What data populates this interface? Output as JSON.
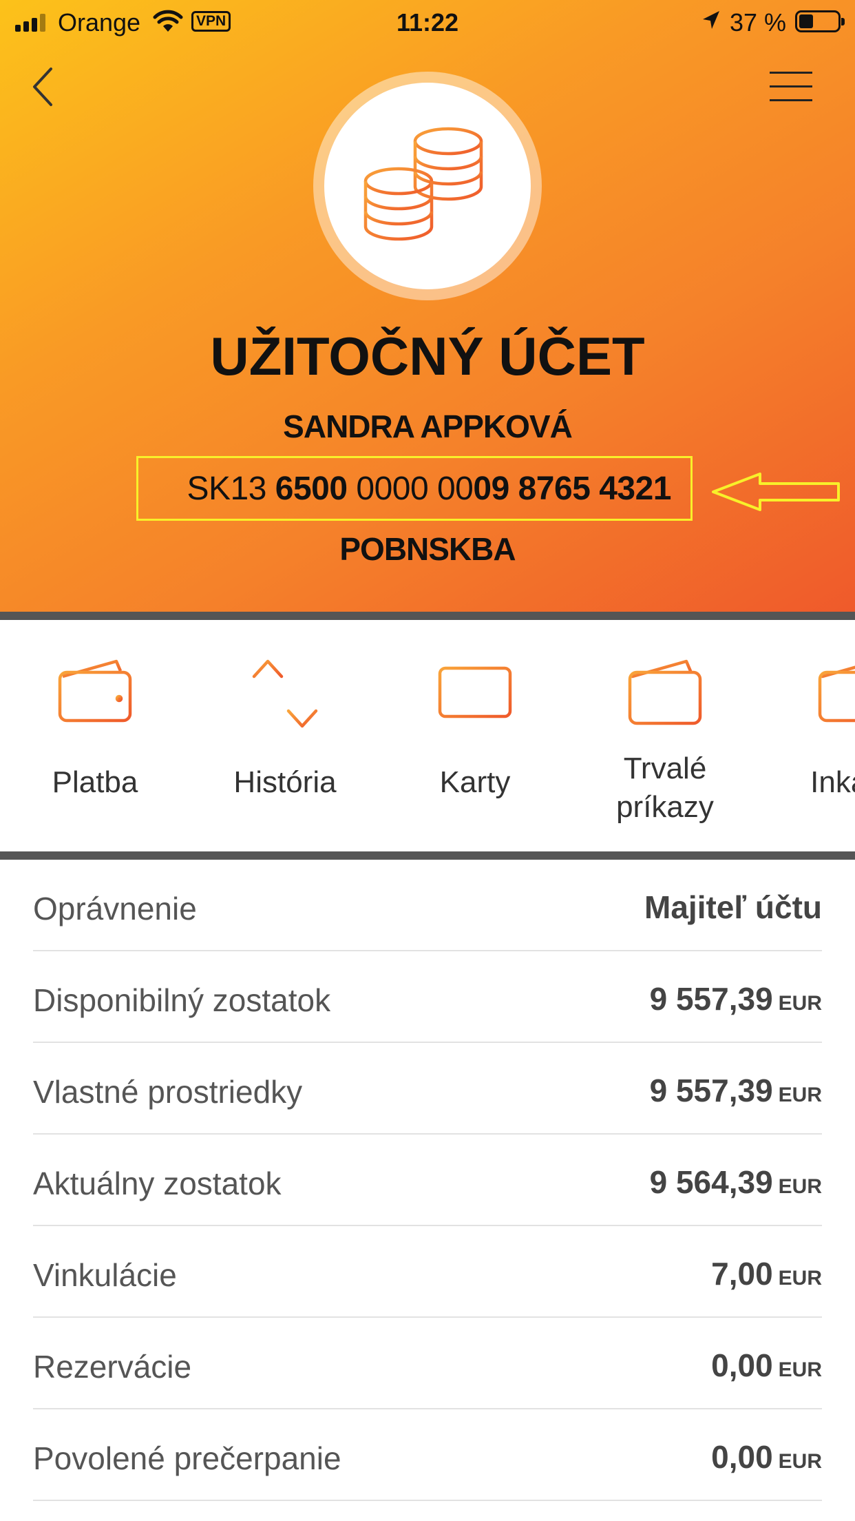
{
  "status_bar": {
    "carrier": "Orange",
    "vpn": "VPN",
    "time": "11:22",
    "battery": "37 %"
  },
  "account": {
    "name": "UŽITOČNÝ ÚČET",
    "owner": "SANDRA APPKOVÁ",
    "iban": {
      "prefix": "SK13 ",
      "part1": "6500",
      "part2": " 0000 00",
      "part3": "09 8765 4321"
    },
    "bank_code": "POBNSKBA"
  },
  "actions": [
    {
      "label": "Platba",
      "icon": "wallet-icon"
    },
    {
      "label": "História",
      "icon": "transfer-arrows-icon"
    },
    {
      "label": "Karty",
      "icon": "card-icon"
    },
    {
      "label_line1": "Trvalé",
      "label_line2": "príkazy",
      "icon": "standing-order-icon"
    },
    {
      "label": "Inkasá",
      "icon": "direct-debit-icon"
    }
  ],
  "details": [
    {
      "label": "Oprávnenie",
      "value": "Majiteľ účtu",
      "currency": ""
    },
    {
      "label": "Disponibilný zostatok",
      "value": "9 557,39",
      "currency": "EUR"
    },
    {
      "label": "Vlastné prostriedky",
      "value": "9 557,39",
      "currency": "EUR"
    },
    {
      "label": "Aktuálny zostatok",
      "value": "9 564,39",
      "currency": "EUR"
    },
    {
      "label": "Vinkulácie",
      "value": "7,00",
      "currency": "EUR"
    },
    {
      "label": "Rezervácie",
      "value": "0,00",
      "currency": "EUR"
    },
    {
      "label": "Povolené prečerpanie",
      "value": "0,00",
      "currency": "EUR"
    }
  ],
  "colors": {
    "accent": "#f5812a",
    "header_top": "#fcc21a",
    "header_bottom": "#ef5a2b",
    "annotation": "#f8f02a"
  }
}
